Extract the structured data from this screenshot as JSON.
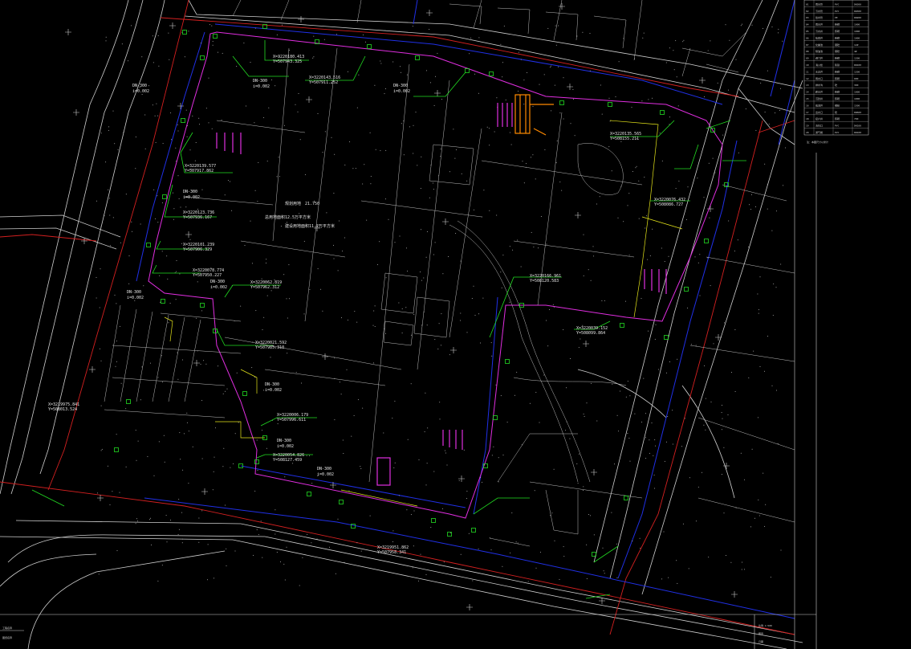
{
  "drawing": {
    "background": "#000000",
    "colors": {
      "road_white": "#cfcfcf",
      "boundary_red": "#d42020",
      "pipe_blue": "#2030e6",
      "pipe_magenta": "#e02ee0",
      "leader_green": "#22dd22",
      "parcel_yellow": "#e6e61a",
      "building_orange": "#ff8a00"
    },
    "coord_labels": [
      {
        "x": "X=3220180.413",
        "y": "Y=507943.325"
      },
      {
        "x": "X=3220143.516",
        "y": "Y=507911.252"
      },
      {
        "x": "X=3220139.577",
        "y": "Y=507917.862"
      },
      {
        "x": "X=3220123.736",
        "y": "Y=507936.167"
      },
      {
        "x": "X=3220101.239",
        "y": "Y=507906.329"
      },
      {
        "x": "X=3220078.774",
        "y": "Y=507950.227"
      },
      {
        "x": "X=3220062.819",
        "y": "Y=507962.312"
      },
      {
        "x": "X=3220021.592",
        "y": "Y=507985.310"
      },
      {
        "x": "X=3220006.179",
        "y": "Y=507996.611"
      },
      {
        "x": "X=3220054.826",
        "y": "Y=508127.459"
      },
      {
        "x": "X=3220166.961",
        "y": "Y=508120.583"
      },
      {
        "x": "X=3220135.565",
        "y": "Y=508155.211"
      },
      {
        "x": "X=3220076.432",
        "y": "Y=508086.727"
      },
      {
        "x": "X=3220039.152",
        "y": "Y=508099.864"
      },
      {
        "x": "X=3219975.841",
        "y": "Y=508013.524"
      },
      {
        "x": "X=3219951.862",
        "y": "Y=507958.341"
      }
    ],
    "pipe_labels": [
      "DN-300",
      "DN-300",
      "DN-300",
      "DN-300",
      "DN-300",
      "DN-300",
      "DN-300",
      "DN-300",
      "DN-300"
    ],
    "slope_labels": [
      "i=0.002",
      "i=0.002",
      "i=0.002",
      "i=0.002",
      "i=0.002",
      "i=0.002",
      "i=0.002",
      "i=0.002",
      "i=0.002"
    ],
    "site_notes": [
      "规划用地",
      "总用地面积12.5万平方米",
      "建设用地面积11.2万平方米"
    ],
    "area_label": "21.750",
    "legend_table": {
      "rows": [
        [
          "01",
          "雨水管",
          "PVC",
          "DN300"
        ],
        [
          "02",
          "污水管",
          "PVC",
          "DN300"
        ],
        [
          "03",
          "给水管",
          "PE",
          "DN200"
        ],
        [
          "04",
          "雨水井",
          "砖砌",
          "1000"
        ],
        [
          "05",
          "污水井",
          "砖砌",
          "1000"
        ],
        [
          "06",
          "检查井",
          "砖砌",
          "1000"
        ],
        [
          "07",
          "化粪池",
          "钢砼",
          "12#"
        ],
        [
          "08",
          "隔油池",
          "钢砼",
          "4#"
        ],
        [
          "09",
          "阀门井",
          "砖砌",
          "1200"
        ],
        [
          "10",
          "消火栓",
          "铸铁",
          "DN100"
        ],
        [
          "11",
          "水表井",
          "砖砌",
          "1200"
        ],
        [
          "12",
          "雨水口",
          "砖砌",
          "680"
        ],
        [
          "13",
          "排水沟",
          "砼",
          "300"
        ],
        [
          "14",
          "跌水井",
          "砖砌",
          "1000"
        ],
        [
          "15",
          "沉砂井",
          "砖砌",
          "1000"
        ],
        [
          "16",
          "截流井",
          "钢砼",
          "1500"
        ],
        [
          "17",
          "出水口",
          "砼",
          "DN600"
        ],
        [
          "18",
          "接户井",
          "砖砌",
          "700"
        ],
        [
          "19",
          "清扫口",
          "PVC",
          "DN100"
        ],
        [
          "20",
          "通气帽",
          "PVC",
          "DN100"
        ]
      ],
      "note": "注：本图尺寸以米计"
    },
    "title_block": {
      "left_lines": [
        "工程名称",
        "图纸名称"
      ],
      "right_lines": [
        "比例 1:500",
        "图号",
        "日期"
      ]
    }
  }
}
